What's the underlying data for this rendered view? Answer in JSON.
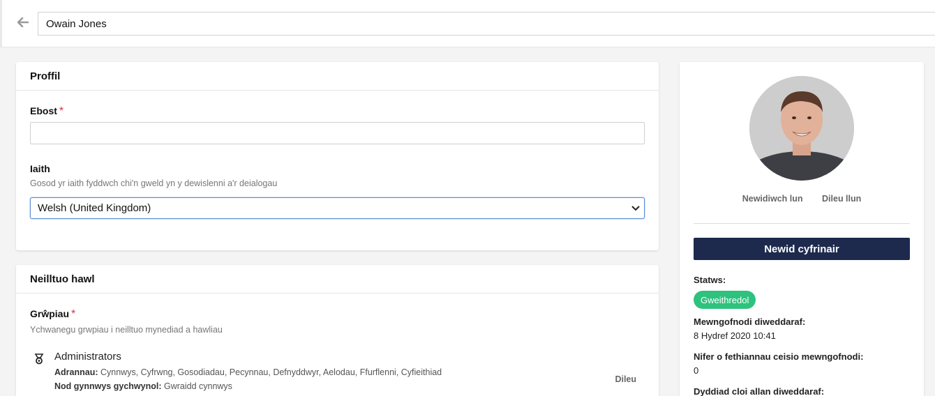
{
  "header": {
    "name_value": "Owain Jones"
  },
  "profile": {
    "title": "Proffil",
    "email_label": "Ebost",
    "email_value": "",
    "required_marker": "*",
    "language_label": "Iaith",
    "language_help": "Gosod yr iaith fyddwch chi'n gweld yn y dewislenni a'r deialogau",
    "language_selected": "Welsh (United Kingdom)"
  },
  "rights": {
    "title": "Neilltuo hawl",
    "groups_label": "Grŵpiau",
    "required_marker": "*",
    "groups_help": "Ychwanegu grwpiau i neilltuo mynediad a hawliau",
    "group": {
      "name": "Administrators",
      "sections_label": "Adrannau:",
      "sections_value": "Cynnwys, Cyfrwng, Gosodiadau, Pecynnau, Defnyddwyr, Aelodau, Ffurflenni, Cyfieithiad",
      "start_node_label": "Nod gynnwys gychwynol:",
      "start_node_value": "Gwraidd cynnwys",
      "delete_label": "Dileu"
    }
  },
  "sidebar": {
    "change_photo": "Newidiwch lun",
    "delete_photo": "Dileu llun",
    "change_password": "Newid cyfrinair",
    "status_label": "Statws:",
    "status_value": "Gweithredol",
    "last_login_label": "Mewngofnodi diweddaraf:",
    "last_login_value": "8 Hydref 2020 10:41",
    "failed_logins_label": "Nifer o fethiannau ceisio mewngofnodi:",
    "failed_logins_value": "0",
    "last_lockout_label": "Dyddiad cloi allan diweddaraf:"
  },
  "colors": {
    "primary_button": "#1d2a4e",
    "status_active": "#2ec27e",
    "required": "#d9304a"
  }
}
